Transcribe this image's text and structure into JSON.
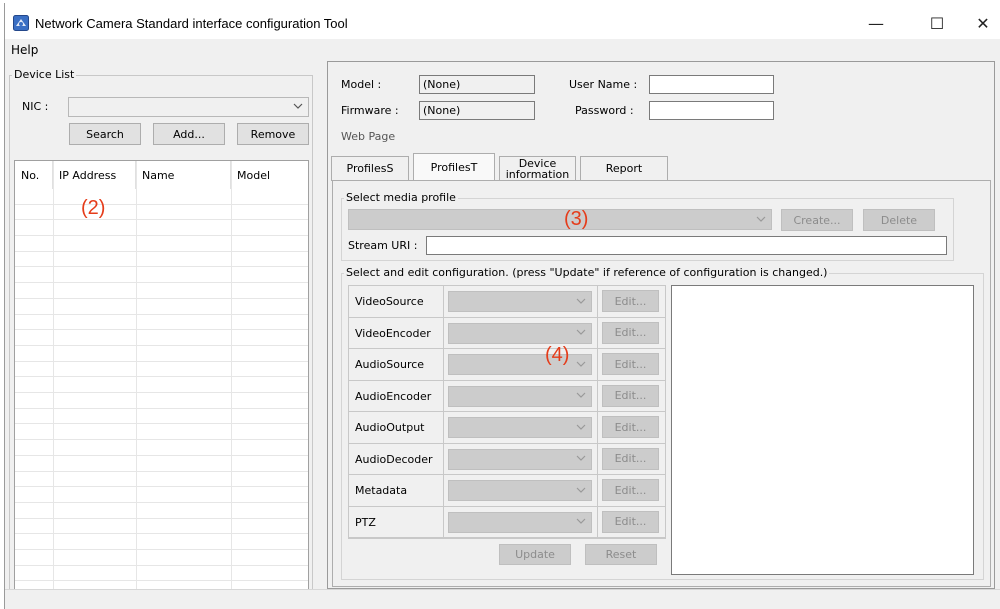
{
  "window": {
    "title": "Network Camera Standard interface configuration Tool",
    "controls": {
      "minimize": "—",
      "maximize": "☐",
      "close": "✕"
    }
  },
  "menu": {
    "items": [
      {
        "label": "Help"
      }
    ]
  },
  "device_list": {
    "legend": "Device List",
    "nic_label": "NIC :",
    "nic_value": "",
    "buttons": {
      "search": "Search",
      "add": "Add...",
      "remove": "Remove"
    },
    "columns": [
      "No.",
      "IP Address",
      "Name",
      "Model"
    ],
    "rows": []
  },
  "device_info": {
    "model_label": "Model :",
    "model_value": "(None)",
    "firmware_label": "Firmware :",
    "firmware_value": "(None)",
    "user_label": "User Name :",
    "user_value": "",
    "password_label": "Password :",
    "password_value": "",
    "web_page_label": "Web Page"
  },
  "tabs": [
    {
      "label": "ProfilesS",
      "active": false
    },
    {
      "label": "ProfilesT",
      "active": true
    },
    {
      "label_line1": "Device",
      "label_line2": "information",
      "active": false
    },
    {
      "label": "Report",
      "active": false
    }
  ],
  "media_profile": {
    "legend": "Select media profile",
    "selected": "",
    "create_label": "Create...",
    "delete_label": "Delete",
    "stream_uri_label": "Stream URI :",
    "stream_uri_value": ""
  },
  "configuration": {
    "legend": "Select and edit configuration. (press \"Update\" if reference of configuration is changed.)",
    "rows": [
      {
        "label": "VideoSource",
        "edit": "Edit..."
      },
      {
        "label": "VideoEncoder",
        "edit": "Edit..."
      },
      {
        "label": "AudioSource",
        "edit": "Edit..."
      },
      {
        "label": "AudioEncoder",
        "edit": "Edit..."
      },
      {
        "label": "AudioOutput",
        "edit": "Edit..."
      },
      {
        "label": "AudioDecoder",
        "edit": "Edit..."
      },
      {
        "label": "Metadata",
        "edit": "Edit..."
      },
      {
        "label": "PTZ",
        "edit": "Edit..."
      }
    ],
    "update_label": "Update",
    "reset_label": "Reset"
  },
  "annotations": {
    "left": "(2)",
    "profile": "(3)",
    "config": "(4)"
  },
  "colors": {
    "annotation": "#e53c1a",
    "panel_bg": "#f0f0f0",
    "disabled_bg": "#cccccc"
  },
  "icons": {
    "app": "camera-tool-icon",
    "dropdown": "chevron-down-icon"
  }
}
